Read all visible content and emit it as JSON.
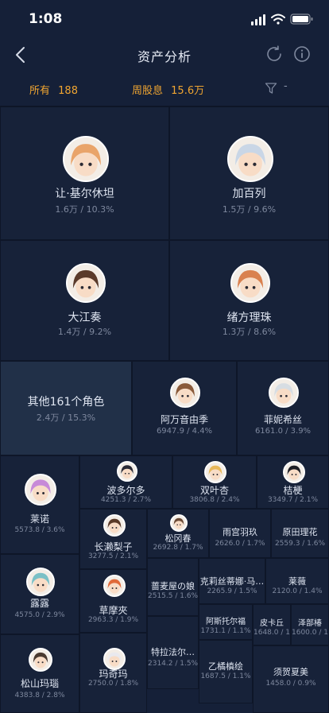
{
  "status_bar": {
    "time": "1:08"
  },
  "header": {
    "title": "资产分析"
  },
  "summary": {
    "total_label": "所有",
    "total_value": "188",
    "weekly_label": "周股息",
    "weekly_value": "15.6万",
    "filter_value": "-"
  },
  "cells": [
    {
      "name": "让·基尔休坦",
      "value": "1.6万 / 10.3%",
      "avatar": "character-avatar",
      "color": "#e9a46a"
    },
    {
      "name": "加百列",
      "value": "1.5万 / 9.6%",
      "avatar": "character-avatar",
      "color": "#c9d6e6"
    },
    {
      "name": "大江奏",
      "value": "1.4万 / 9.2%",
      "avatar": "character-avatar",
      "color": "#5a3a2a"
    },
    {
      "name": "绪方理珠",
      "value": "1.3万 / 8.6%",
      "avatar": "character-avatar",
      "color": "#d9814f"
    },
    {
      "name": "其他161个角色",
      "value": "2.4万 / 15.3%",
      "avatar": "",
      "color": ""
    },
    {
      "name": "阿万音由季",
      "value": "6947.9 / 4.4%",
      "avatar": "character-avatar",
      "color": "#8a5a3a"
    },
    {
      "name": "菲妮希丝",
      "value": "6161.0 / 3.9%",
      "avatar": "character-avatar",
      "color": "#d7dde3"
    },
    {
      "name": "莱诺",
      "value": "5573.8 / 3.6%",
      "avatar": "character-avatar",
      "color": "#c78ad8"
    },
    {
      "name": "波多尔多",
      "value": "4251.3 / 2.7%",
      "avatar": "character-avatar",
      "color": "#2a2a35"
    },
    {
      "name": "双叶杏",
      "value": "3806.8 / 2.4%",
      "avatar": "character-avatar",
      "color": "#e8b85a"
    },
    {
      "name": "桔梗",
      "value": "3349.7 / 2.1%",
      "avatar": "character-avatar",
      "color": "#1e1e24"
    },
    {
      "name": "长濑梨子",
      "value": "3277.5 / 2.1%",
      "avatar": "character-avatar",
      "color": "#5a3a28"
    },
    {
      "name": "松冈春",
      "value": "2692.8 / 1.7%",
      "avatar": "character-avatar",
      "color": "#6b4a36"
    },
    {
      "name": "雨宫羽玖",
      "value": "2626.0 / 1.7%",
      "avatar": "",
      "color": ""
    },
    {
      "name": "原田理花",
      "value": "2559.3 / 1.6%",
      "avatar": "",
      "color": ""
    },
    {
      "name": "露露",
      "value": "4575.0 / 2.9%",
      "avatar": "character-avatar",
      "color": "#7ac0c6"
    },
    {
      "name": "草摩夾",
      "value": "2963.3 / 1.9%",
      "avatar": "character-avatar",
      "color": "#e06a3a"
    },
    {
      "name": "蔷麦屋の娘",
      "value": "2515.5 / 1.6%",
      "avatar": "",
      "color": ""
    },
    {
      "name": "克莉丝蒂娜·马…",
      "value": "2265.9 / 1.5%",
      "avatar": "",
      "color": ""
    },
    {
      "name": "莱薇",
      "value": "2120.0 / 1.4%",
      "avatar": "",
      "color": ""
    },
    {
      "name": "阿斯托尔福",
      "value": "1731.1 / 1.1%",
      "avatar": "",
      "color": ""
    },
    {
      "name": "皮卡丘",
      "value": "1648.0 / 1.1%",
      "avatar": "",
      "color": ""
    },
    {
      "name": "泽部椿",
      "value": "1600.0 / 1.0%",
      "avatar": "",
      "color": ""
    },
    {
      "name": "松山玛瑙",
      "value": "4383.8 / 2.8%",
      "avatar": "character-avatar",
      "color": "#4a3a30"
    },
    {
      "name": "玛奇玛",
      "value": "2750.0 / 1.8%",
      "avatar": "character-avatar",
      "color": "#e9e9ee"
    },
    {
      "name": "特拉法尔…",
      "value": "2314.2 / 1.5%",
      "avatar": "",
      "color": ""
    },
    {
      "name": "乙橘槙绘",
      "value": "1687.5 / 1.1%",
      "avatar": "",
      "color": ""
    },
    {
      "name": "须贺夏美",
      "value": "1458.0 / 0.9%",
      "avatar": "",
      "color": ""
    }
  ]
}
